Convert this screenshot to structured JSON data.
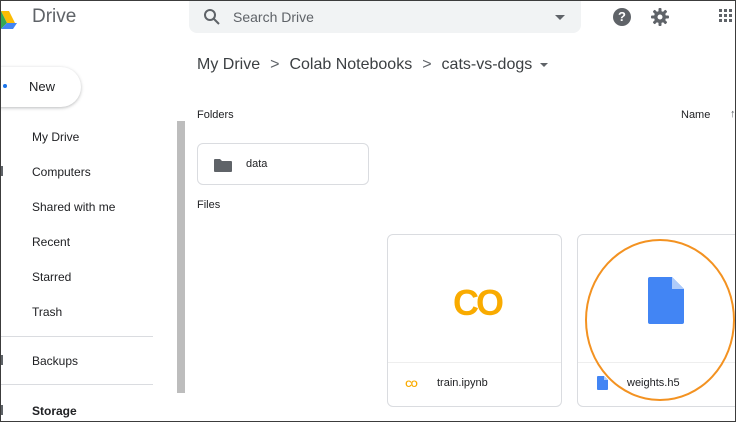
{
  "header": {
    "app_title": "Drive",
    "search_placeholder": "Search Drive",
    "help_glyph": "?"
  },
  "sidebar": {
    "new_label": "New",
    "items": [
      {
        "label": "My Drive"
      },
      {
        "label": "Computers"
      },
      {
        "label": "Shared with me"
      },
      {
        "label": "Recent"
      },
      {
        "label": "Starred"
      },
      {
        "label": "Trash"
      },
      {
        "label": "Backups"
      },
      {
        "label": "Storage"
      }
    ]
  },
  "breadcrumb": {
    "items": [
      "My Drive",
      "Colab Notebooks",
      "cats-vs-dogs"
    ],
    "separator": ">"
  },
  "main": {
    "folders_label": "Folders",
    "files_label": "Files",
    "sort_label": "Name",
    "sort_arrow": "↑",
    "folders": [
      {
        "name": "data"
      }
    ],
    "files": [
      {
        "name": "train.ipynb",
        "type": "colab-notebook",
        "icon": "colab-icon",
        "logo_text": "CO"
      },
      {
        "name": "weights.h5",
        "type": "file",
        "icon": "document-icon"
      }
    ]
  },
  "colors": {
    "colab_orange": "#f9ab00",
    "doc_blue": "#4285f4",
    "highlight_orange": "#f39221"
  }
}
